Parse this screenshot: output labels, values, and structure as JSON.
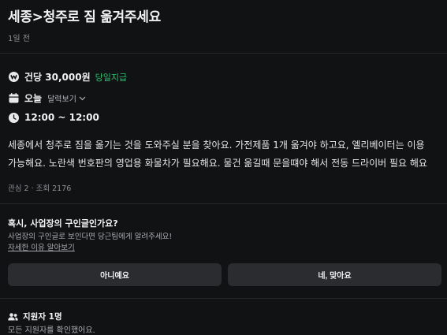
{
  "post": {
    "title": "세종>청주로 짐 옮겨주세요",
    "posted_ago": "1일 전"
  },
  "details": {
    "pay_amount": "건당 30,000원",
    "pay_badge": "당일지급",
    "date_label": "오늘",
    "calendar_link": "달력보기",
    "time_range": "12:00 ~ 12:00",
    "icons": [
      "won-coin-icon",
      "calendar-icon",
      "clock-icon",
      "chevron-down-icon"
    ]
  },
  "description": "세종에서 청주로 짐을 옮기는 것을 도와주실 분을 찾아요. 가전제품 1개 옮겨야 하고요, 엘리베이터는 이용 가능해요. 노란색 번호판의 영업용 화물차가 필요해요. 물건 옮길때 문을떄야 해서 전동 드라이버 필요 해요",
  "meta": "관심 2 · 조회 2176",
  "business_check": {
    "question": "혹시, 사업장의 구인글인가요?",
    "hint": "사업장의 구인글로 보인다면 당근팀에게 알려주세요!",
    "reason_link": "자세한 이유 알아보기",
    "no_label": "아니예요",
    "yes_label": "네, 맞아요"
  },
  "applicants": {
    "count_label": "지원자 1명",
    "status": "모든 지원자를 확인했어요."
  },
  "colors": {
    "background": "#111214",
    "accent_green": "#2fbf71",
    "button_bg": "#2a2c30"
  }
}
